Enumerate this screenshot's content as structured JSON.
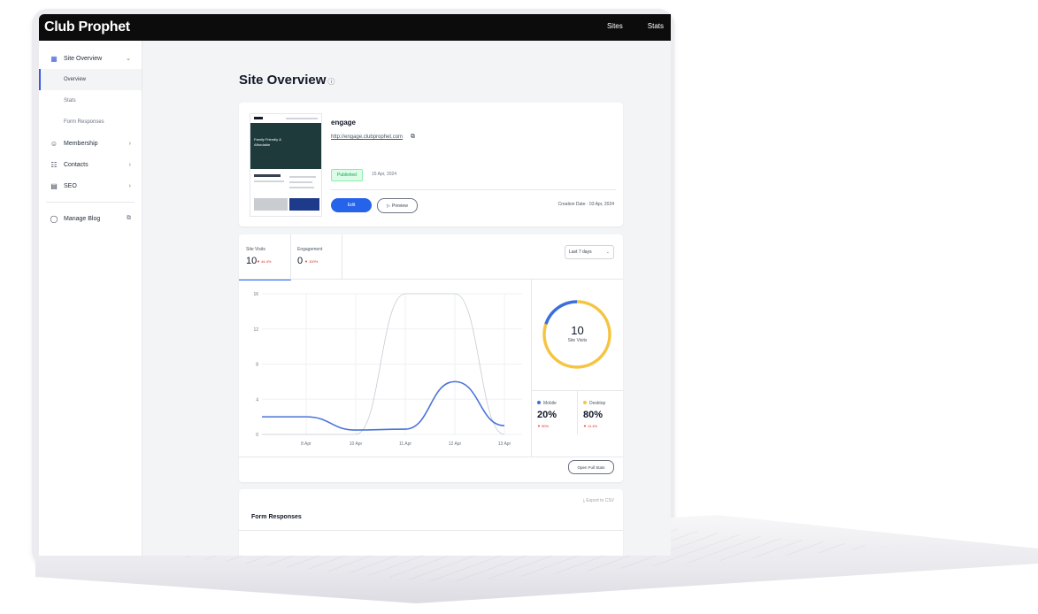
{
  "app": {
    "brand": "Club Prophet",
    "nav": [
      "Sites",
      "Stats"
    ]
  },
  "sidebar": {
    "items": [
      {
        "label": "Site Overview",
        "icon": "layout-icon"
      },
      {
        "label": "Membership",
        "icon": "user-icon"
      },
      {
        "label": "Contacts",
        "icon": "contacts-icon"
      },
      {
        "label": "SEO",
        "icon": "seo-icon"
      },
      {
        "label": "Manage Blog",
        "icon": "chat-icon"
      }
    ],
    "subitems": [
      "Overview",
      "Stats",
      "Form Responses"
    ]
  },
  "page": {
    "title": "Site Overview"
  },
  "site": {
    "name": "engage",
    "url": "http://engage.clubprophet.com",
    "status": "Published",
    "published_date": "15 Apr, 2024",
    "edit_label": "Edit",
    "preview_label": "Preview",
    "creation": "Creation Date · 03 Apr, 2024",
    "thumb_text": "Family Friendly & Affordable"
  },
  "stats": {
    "tabs": [
      {
        "label": "Site Visits",
        "value": "10",
        "change": "▼ 44.4%"
      },
      {
        "label": "Engagement",
        "value": "0",
        "change": "▼ 100%"
      }
    ],
    "range": "Last 7 days",
    "donut": {
      "value": "10",
      "label": "Site Visits",
      "mobile_pct": 20,
      "desktop_pct": 80
    },
    "split": [
      {
        "label": "Mobile",
        "value": "20%",
        "change": "▼ 50%",
        "color": "#3b6fd8"
      },
      {
        "label": "Desktop",
        "value": "80%",
        "change": "▼ 11.4%",
        "color": "#f5c542"
      }
    ],
    "full_stats_label": "Open Full Stats"
  },
  "chart_data": {
    "type": "line",
    "x": [
      "8 Apr",
      "10 Apr",
      "11 Apr",
      "12 Apr",
      "13 Apr"
    ],
    "yticks": [
      "0",
      "4",
      "8",
      "12",
      "16"
    ],
    "ylim": [
      0,
      16
    ],
    "series": [
      {
        "values": [
          2,
          0.5,
          0.6,
          6,
          1
        ],
        "color": "#4a73d9"
      },
      {
        "values": [
          0,
          0,
          16,
          16,
          0
        ],
        "color": "#c7cbd3"
      }
    ]
  },
  "forms": {
    "title": "Form Responses",
    "export_label": "Export to CSV"
  }
}
